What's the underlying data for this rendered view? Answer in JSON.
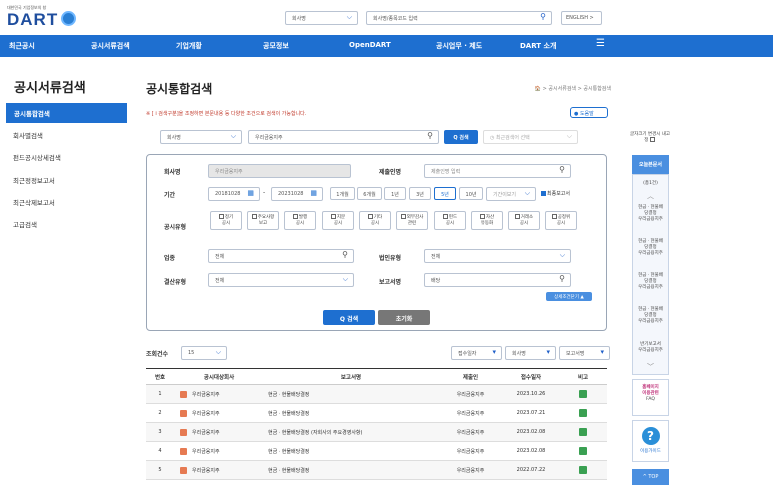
{
  "header": {
    "logo_small": "대한민국 기업정보의 창",
    "logo": "DART",
    "search_select": "회사명",
    "search_placeholder": "회사명/종목코드 입력",
    "english_btn": "ENGLISH >"
  },
  "nav": [
    "최근공시",
    "공시서류검색",
    "기업개황",
    "공모정보",
    "OpenDART",
    "공시업무 · 제도",
    "DART 소개"
  ],
  "sidebar": {
    "title": "공시서류검색",
    "items": [
      "공시통합검색",
      "회사별검색",
      "펀드공시상세검색",
      "최근정정보고서",
      "최근삭제보고서",
      "고급검색"
    ]
  },
  "page": {
    "title": "공시통합검색",
    "breadcrumb": "🏠 > 공시서류검색 > 공시통합검색",
    "notice": "※ [ i 검색구분]을 조정하면 본문내용 등 다양한 조건으로 검색이 가능합니다.",
    "help": "● 도움말"
  },
  "topsearch": {
    "select": "회사명",
    "value": "우리금융지주",
    "search_btn": "Q 검색",
    "recent": "최근검색어 선택"
  },
  "form": {
    "company_label": "회사명",
    "company_value": "우리금융지주",
    "submitter_label": "제출인명",
    "submitter_placeholder": "제출인명 입력",
    "period_label": "기간",
    "date_from": "20181028",
    "date_to": "20231028",
    "period_buttons": [
      "1개월",
      "6개월",
      "1년",
      "3년",
      "5년",
      "10년"
    ],
    "period_select": "기간이보기",
    "final_report": "최종보고서",
    "type_label": "공시유형",
    "types": [
      [
        "정기",
        "공시"
      ],
      [
        "주요사항",
        "보고"
      ],
      [
        "발행",
        "공시"
      ],
      [
        "지분",
        "공시"
      ],
      [
        "기타",
        "공시"
      ],
      [
        "외부감사",
        "관련"
      ],
      [
        "펀드",
        "공시"
      ],
      [
        "자산",
        "유동화"
      ],
      [
        "거래소",
        "공시"
      ],
      [
        "공정위",
        "공시"
      ]
    ],
    "industry_label": "업종",
    "industry_value": "전체",
    "corp_type_label": "법인유형",
    "corp_type_value": "전체",
    "settle_label": "결산유형",
    "settle_value": "전체",
    "report_label": "보고서명",
    "report_value": "배당",
    "detail_toggle": "상세조건닫기 ▲",
    "search_btn": "Q 검색",
    "reset_btn": "초기화"
  },
  "result_bar": {
    "count_label": "조회건수",
    "count_value": "15",
    "sort": [
      "접수일자",
      "회사명",
      "보고서명"
    ]
  },
  "results": {
    "headers": [
      "번호",
      "공시대상회사",
      "보고서명",
      "제출인",
      "접수일자",
      "비고"
    ],
    "rows": [
      {
        "no": "1",
        "company": "우리금융지주",
        "report": "현금ㆍ현물배당결정",
        "submitter": "우리금융지주",
        "date": "2023.10.26"
      },
      {
        "no": "2",
        "company": "우리금융지주",
        "report": "현금ㆍ현물배당결정",
        "submitter": "우리금융지주",
        "date": "2023.07.21"
      },
      {
        "no": "3",
        "company": "우리금융지주",
        "report": "현금ㆍ현물배당결정 (자회사의 주요경영사항)",
        "submitter": "우리금융지주",
        "date": "2023.02.08"
      },
      {
        "no": "4",
        "company": "우리금융지주",
        "report": "현금ㆍ현물배당결정",
        "submitter": "우리금융지주",
        "date": "2023.02.08"
      },
      {
        "no": "5",
        "company": "우리금융지주",
        "report": "현금ㆍ현물배당결정",
        "submitter": "우리금융지주",
        "date": "2022.07.22"
      }
    ]
  },
  "right_panel": {
    "font_size": "글자크기 변경시 내고정",
    "recent_docs": "오늘본문서",
    "count": "(총1건)",
    "docs": [
      [
        "현금ㆍ현물배",
        "당결정",
        "우리금융지주"
      ],
      [
        "현금ㆍ현물배",
        "당결정",
        "우리금융지주"
      ],
      [
        "현금ㆍ현물배",
        "당결정",
        "우리금융지주"
      ],
      [
        "현금ㆍ현물배",
        "당결정",
        "우리금융지주"
      ],
      [
        "반기보고서",
        "우리금융지주"
      ]
    ],
    "faq1": "홈페이지",
    "faq2": "이용관련",
    "faq3": "FAQ",
    "guide": "이용가이드",
    "top": "^ TOP"
  },
  "colors": {
    "brand": "#1e6fd0",
    "accent_link": "#c0337a",
    "notice": "#c0392b"
  }
}
